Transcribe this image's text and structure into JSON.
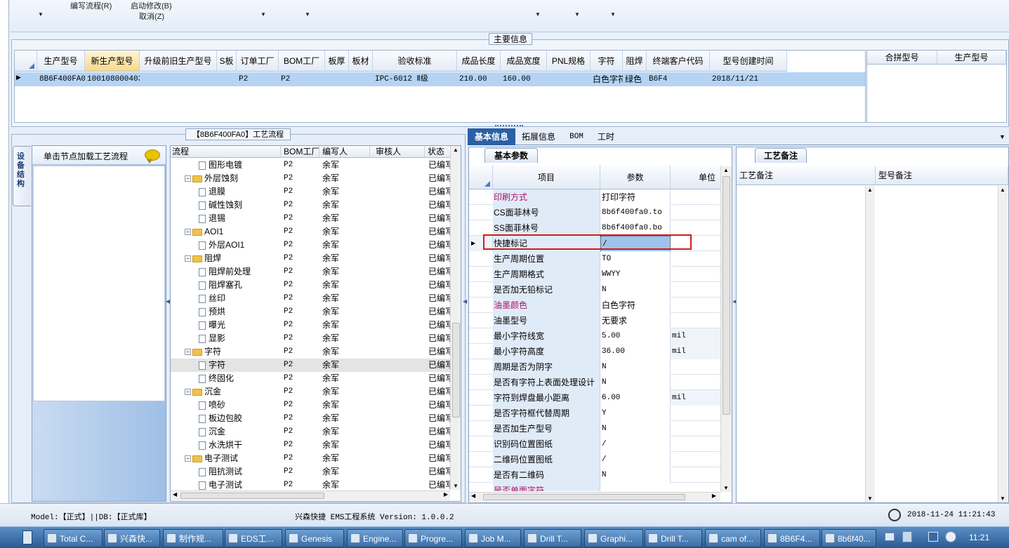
{
  "menu": {
    "item1": "编写流程(R)",
    "item2": "启动修改(B)",
    "item3": "取消(Z)"
  },
  "main_info": {
    "legend": "主要信息",
    "columns": [
      "生产型号",
      "新生产型号",
      "升级前旧生产型号",
      "S板",
      "订单工厂",
      "BOM工厂",
      "板厚",
      "板材",
      "验收标准",
      "成品长度",
      "成品宽度",
      "PNL规格",
      "字符",
      "阻焊",
      "终端客户代码",
      "型号创建时间"
    ],
    "row": [
      "8B6F400FA0",
      "10010800040372",
      "",
      "",
      "P2",
      "P2",
      "",
      "",
      "IPC-6012 Ⅱ级",
      "210.00",
      "160.00",
      "",
      "白色字符",
      "绿色",
      "B6F4",
      "2018/11/21"
    ],
    "side_columns": [
      "合拼型号",
      "生产型号"
    ]
  },
  "flow": {
    "legend": "【8B6F400FA0】工艺流程",
    "node_tab": "设备结构",
    "node_hint": "单击节点加载工艺流程",
    "columns": [
      "流程",
      "BOM工厂",
      "编写人",
      "审核人",
      "状态"
    ],
    "rows": [
      {
        "name": "图形电镀",
        "level": 2,
        "bom": "P2",
        "author": "余军",
        "status": "已编写"
      },
      {
        "name": "外层蚀刻",
        "level": 1,
        "bom": "P2",
        "author": "余军",
        "status": "已编写"
      },
      {
        "name": "退膜",
        "level": 2,
        "bom": "P2",
        "author": "余军",
        "status": "已编写"
      },
      {
        "name": "碱性蚀刻",
        "level": 2,
        "bom": "P2",
        "author": "余军",
        "status": "已编写"
      },
      {
        "name": "退锡",
        "level": 2,
        "bom": "P2",
        "author": "余军",
        "status": "已编写"
      },
      {
        "name": "AOI1",
        "level": 1,
        "bom": "P2",
        "author": "余军",
        "status": "已编写"
      },
      {
        "name": "外层AOI1",
        "level": 2,
        "bom": "P2",
        "author": "余军",
        "status": "已编写"
      },
      {
        "name": "阻焊",
        "level": 1,
        "bom": "P2",
        "author": "余军",
        "status": "已编写"
      },
      {
        "name": "阻焊前处理",
        "level": 2,
        "bom": "P2",
        "author": "余军",
        "status": "已编写"
      },
      {
        "name": "阻焊塞孔",
        "level": 2,
        "bom": "P2",
        "author": "余军",
        "status": "已编写"
      },
      {
        "name": "丝印",
        "level": 2,
        "bom": "P2",
        "author": "余军",
        "status": "已编写"
      },
      {
        "name": "预烘",
        "level": 2,
        "bom": "P2",
        "author": "余军",
        "status": "已编写"
      },
      {
        "name": "曝光",
        "level": 2,
        "bom": "P2",
        "author": "余军",
        "status": "已编写"
      },
      {
        "name": "显影",
        "level": 2,
        "bom": "P2",
        "author": "余军",
        "status": "已编写"
      },
      {
        "name": "字符",
        "level": 1,
        "bom": "P2",
        "author": "余军",
        "status": "已编写"
      },
      {
        "name": "字符",
        "level": 2,
        "bom": "P2",
        "author": "余军",
        "status": "已编写"
      },
      {
        "name": "终固化",
        "level": 2,
        "bom": "P2",
        "author": "余军",
        "status": "已编写"
      },
      {
        "name": "沉金",
        "level": 1,
        "bom": "P2",
        "author": "余军",
        "status": "已编写"
      },
      {
        "name": "喷砂",
        "level": 2,
        "bom": "P2",
        "author": "余军",
        "status": "已编写"
      },
      {
        "name": "板边包胶",
        "level": 2,
        "bom": "P2",
        "author": "余军",
        "status": "已编写"
      },
      {
        "name": "沉金",
        "level": 2,
        "bom": "P2",
        "author": "余军",
        "status": "已编写"
      },
      {
        "name": "水洗烘干",
        "level": 2,
        "bom": "P2",
        "author": "余军",
        "status": "已编写"
      },
      {
        "name": "电子测试",
        "level": 1,
        "bom": "P2",
        "author": "余军",
        "status": "已编写"
      },
      {
        "name": "阻抗测试",
        "level": 2,
        "bom": "P2",
        "author": "余军",
        "status": "已编写"
      },
      {
        "name": "电子测试",
        "level": 2,
        "bom": "P2",
        "author": "余军",
        "status": "已编写"
      }
    ]
  },
  "tabs": [
    "基本信息",
    "拓展信息",
    "BOM",
    "工时"
  ],
  "basic": {
    "tab": "基本参数",
    "columns": [
      "项目",
      "参数",
      "单位"
    ],
    "rows": [
      {
        "item": "印刷方式",
        "value": "打印字符",
        "unit": "",
        "pink": true
      },
      {
        "item": "CS面菲林号",
        "value": "8b6f400fa0.to",
        "unit": ""
      },
      {
        "item": "SS面菲林号",
        "value": "8b6f400fa0.bo",
        "unit": ""
      },
      {
        "item": "快捷标记",
        "value": "/",
        "unit": "",
        "current": true
      },
      {
        "item": "生产周期位置",
        "value": "TO",
        "unit": ""
      },
      {
        "item": "生产周期格式",
        "value": "WWYY",
        "unit": ""
      },
      {
        "item": "是否加无铅标记",
        "value": "N",
        "unit": ""
      },
      {
        "item": "油墨颜色",
        "value": "白色字符",
        "unit": "",
        "pink": true
      },
      {
        "item": "油墨型号",
        "value": "无要求",
        "unit": ""
      },
      {
        "item": "最小字符线宽",
        "value": "5.00",
        "unit": "mil"
      },
      {
        "item": "最小字符高度",
        "value": "36.00",
        "unit": "mil"
      },
      {
        "item": "周期是否为阴字",
        "value": "N",
        "unit": ""
      },
      {
        "item": "是否有字符上表面处理设计",
        "value": "N",
        "unit": ""
      },
      {
        "item": "字符到焊盘最小距离",
        "value": "6.00",
        "unit": "mil"
      },
      {
        "item": "是否字符框代替周期",
        "value": "Y",
        "unit": ""
      },
      {
        "item": "是否加生产型号",
        "value": "N",
        "unit": ""
      },
      {
        "item": "识别码位置图纸",
        "value": "/",
        "unit": ""
      },
      {
        "item": "二维码位置图纸",
        "value": "/",
        "unit": ""
      },
      {
        "item": "是否有二维码",
        "value": "N",
        "unit": ""
      },
      {
        "item": "是否单面字符",
        "value": "",
        "unit": "",
        "pink": true
      }
    ]
  },
  "notes": {
    "tab": "工艺备注",
    "col1": "工艺备注",
    "col2": "型号备注"
  },
  "status": {
    "left": "Model:【正式】||DB:【正式库】",
    "center": "兴森快捷 EMS工程系统 Version: 1.0.0.2",
    "time": "2018-11-24 11:21:43"
  },
  "taskbar": {
    "items": [
      "Total C...",
      "兴森快...",
      "制作规...",
      "EDS工...",
      "Genesis",
      "Engine...",
      "Progre...",
      "Job M...",
      "Drill T...",
      "Graphi...",
      "Drill T...",
      "cam of...",
      "8B6F4...",
      "8b6f40..."
    ],
    "clock": "11:21"
  }
}
